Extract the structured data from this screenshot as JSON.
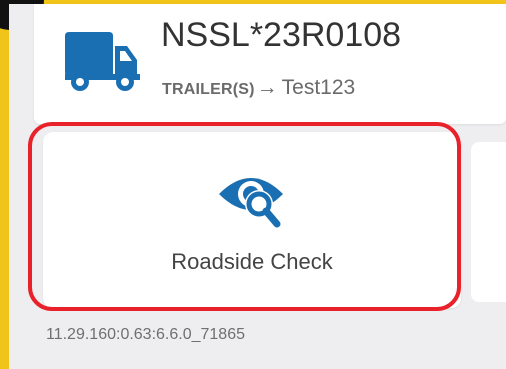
{
  "vehicle": {
    "id": "NSSL*23R0108",
    "icon": "truck-icon",
    "trailer_prefix": "TRAILER(S)",
    "trailer_arrow": "→",
    "trailer_value": "Test123"
  },
  "actions": [
    {
      "label": "Roadside Check",
      "icon": "eye-search-icon"
    }
  ],
  "footer": {
    "version": "11.29.160:0.63:6.6.0_71865"
  },
  "colors": {
    "accent_blue": "#1a6fb3",
    "highlight_red": "#e8212a",
    "device_frame": "#f0c419",
    "background": "#eeeef0"
  }
}
